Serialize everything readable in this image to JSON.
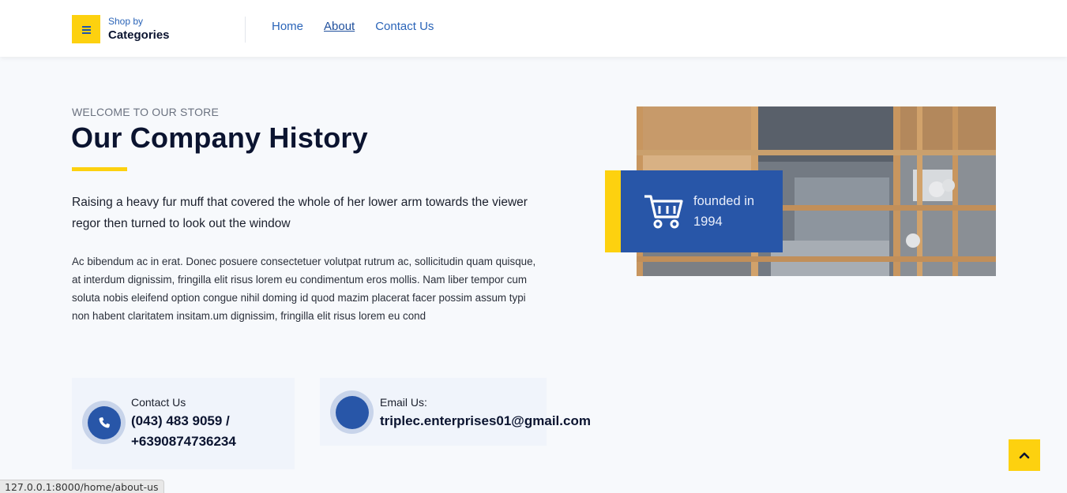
{
  "header": {
    "categories_small": "Shop by",
    "categories_big": "Categories",
    "nav": [
      {
        "label": "Home"
      },
      {
        "label": "About"
      },
      {
        "label": "Contact Us"
      }
    ]
  },
  "hero": {
    "eyebrow": "WELCOME TO OUR STORE",
    "title": "Our Company History",
    "lead": "Raising a heavy fur muff that covered the whole of her lower arm towards the viewer regor then turned to look out the window",
    "body": "Ac bibendum ac in erat. Donec posuere consectetuer volutpat rutrum ac, sollicitudin quam quisque, at interdum dignissim, fringilla elit risus lorem eu condimentum eros mollis. Nam liber tempor cum soluta nobis eleifend option congue nihil doming id quod mazim placerat facer possim assum typi non habent claritatem insitam.um dignissim, fringilla elit risus lorem eu cond"
  },
  "badge": {
    "icon": "cart-icon",
    "text": "founded in 1994"
  },
  "contacts": {
    "phone_label": "Contact Us",
    "phone_value": "(043) 483 9059 / +6390874736234",
    "phone_icon": "phone-icon",
    "email_label": "Email Us:",
    "email_value": "triplec.enterprises01@gmail.com",
    "email_icon": "mail-icon"
  },
  "colors": {
    "accent_yellow": "#fdd10f",
    "brand_blue": "#2856a8",
    "link_blue": "#2a64b8"
  },
  "status_url": "127.0.0.1:8000/home/about-us"
}
